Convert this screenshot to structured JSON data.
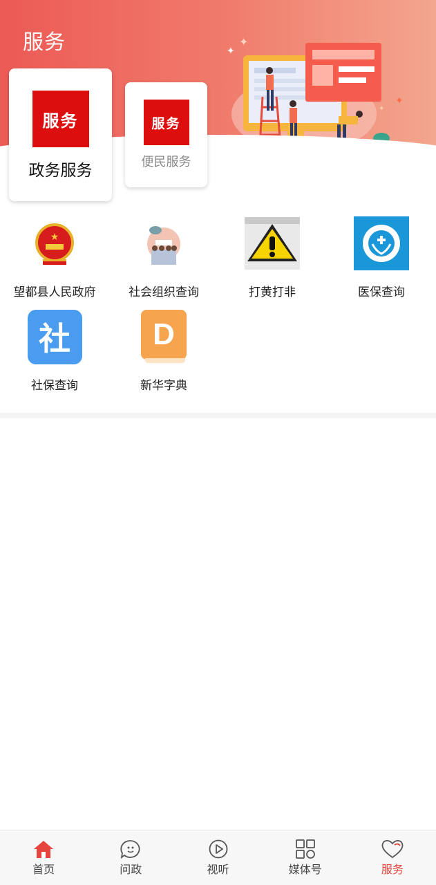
{
  "header": {
    "title": "服务"
  },
  "cards": [
    {
      "logo_text": "服务",
      "label": "政务服务"
    },
    {
      "logo_text": "服务",
      "label": "便民服务"
    }
  ],
  "services": [
    {
      "label": "望都县人民政府",
      "icon": "national-emblem-icon"
    },
    {
      "label": "社会组织查询",
      "icon": "community-group-icon"
    },
    {
      "label": "打黄打非",
      "icon": "warning-sign-icon"
    },
    {
      "label": "医保查询",
      "icon": "medical-insurance-icon"
    },
    {
      "label": "社保查询",
      "icon": "social-security-icon",
      "glyph": "社"
    },
    {
      "label": "新华字典",
      "icon": "dictionary-icon",
      "glyph": "D"
    }
  ],
  "nav": [
    {
      "label": "首页",
      "icon": "home-icon",
      "active": false
    },
    {
      "label": "问政",
      "icon": "chat-icon",
      "active": false
    },
    {
      "label": "视听",
      "icon": "play-icon",
      "active": false
    },
    {
      "label": "媒体号",
      "icon": "grid-icon",
      "active": false
    },
    {
      "label": "服务",
      "icon": "heart-icon",
      "active": true
    }
  ],
  "colors": {
    "accent": "#e5453d",
    "banner_start": "#ec5a55",
    "banner_end": "#f3a68e",
    "logo_red": "#dd0e0e"
  }
}
